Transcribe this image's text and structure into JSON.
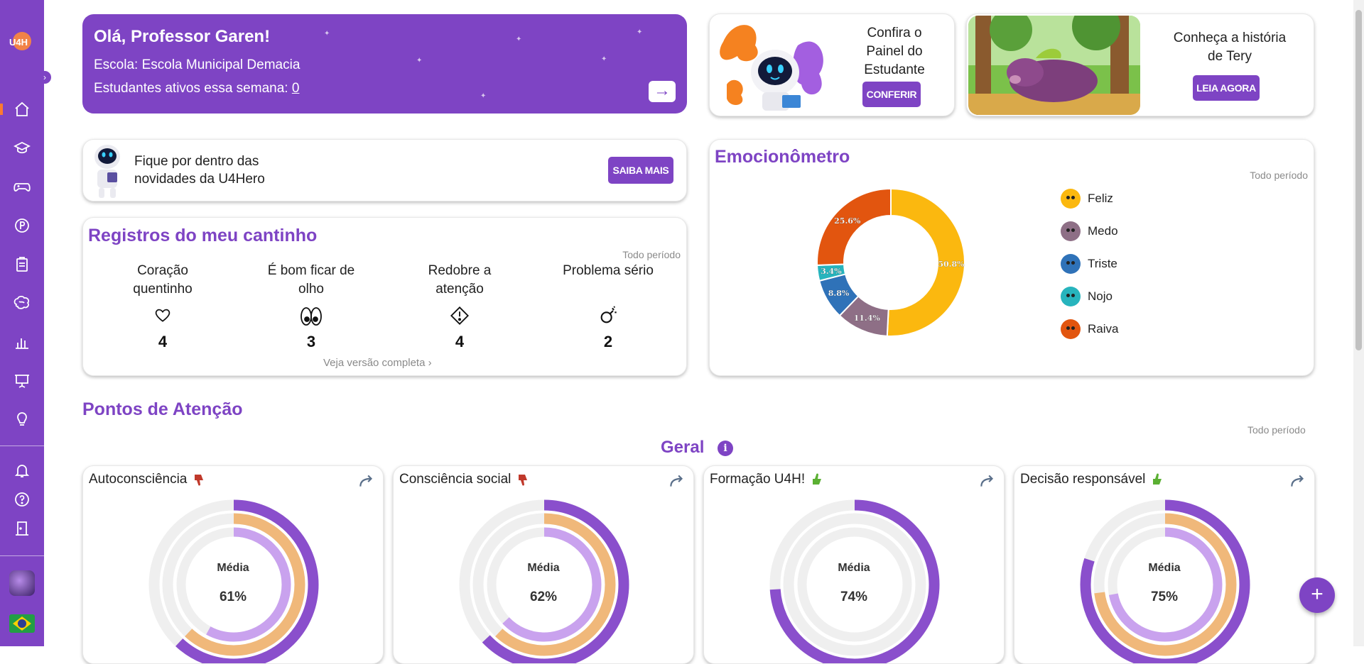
{
  "sidebar": {
    "logo_alt": "U4Hero",
    "items": [
      {
        "name": "home-icon",
        "active": true
      },
      {
        "name": "graduation-icon"
      },
      {
        "name": "gamepad-icon"
      },
      {
        "name": "p-coin-icon"
      },
      {
        "name": "clipboard-icon"
      },
      {
        "name": "brain-icon"
      },
      {
        "name": "bar-chart-icon"
      },
      {
        "name": "presentation-icon"
      },
      {
        "name": "lightbulb-icon"
      },
      {
        "name": "bell-icon"
      },
      {
        "name": "help-icon"
      },
      {
        "name": "logout-door-icon"
      }
    ]
  },
  "welcome": {
    "greeting": "Olá, Professor Garen!",
    "school": "Escola: Escola Municipal Demacia",
    "active_label": "Estudantes ativos essa semana: ",
    "active_count": "0"
  },
  "promo_student": {
    "title": "Confira o Painel do Estudante",
    "button": "CONFERIR"
  },
  "promo_story": {
    "title": "Conheça a história de Tery",
    "button": "LEIA AGORA"
  },
  "news": {
    "text": "Fique por dentro das novidades da U4Hero",
    "button": "SAIBA MAIS"
  },
  "registros": {
    "title": "Registros do meu cantinho",
    "period": "Todo período",
    "items": [
      {
        "label": "Coração quentinho",
        "count": "4",
        "icon": "heart-icon"
      },
      {
        "label": "É bom ficar de olho",
        "count": "3",
        "icon": "eyes-icon"
      },
      {
        "label": "Redobre a atenção",
        "count": "4",
        "icon": "warning-icon"
      },
      {
        "label": "Problema sério",
        "count": "2",
        "icon": "bomb-icon"
      }
    ],
    "link": "Veja versão completa"
  },
  "emocionometro": {
    "title": "Emocionômetro",
    "period": "Todo período",
    "legend": [
      {
        "label": "Feliz",
        "color": "#fbb80f"
      },
      {
        "label": "Medo",
        "color": "#8e6f86"
      },
      {
        "label": "Triste",
        "color": "#2f72b8"
      },
      {
        "label": "Nojo",
        "color": "#27b4bd"
      },
      {
        "label": "Raiva",
        "color": "#e2550f"
      }
    ]
  },
  "chart_data": {
    "type": "pie",
    "categories": [
      "Feliz",
      "Medo",
      "Triste",
      "Nojo",
      "Raiva"
    ],
    "values": [
      50.8,
      11.4,
      8.8,
      3.4,
      25.6
    ],
    "labels": [
      "50.8%",
      "11.4%",
      "8.8%",
      "3.4%",
      "25.6%"
    ],
    "colors": [
      "#fbb80f",
      "#8e6f86",
      "#2f72b8",
      "#27b4bd",
      "#e2550f"
    ],
    "donut": true,
    "legend": "right"
  },
  "pontos": {
    "title": "Pontos de Atenção",
    "period": "Todo período",
    "group": "Geral",
    "media_label": "Média",
    "cards": [
      {
        "title": "Autoconsciência",
        "thumb": "down",
        "pct": "61%",
        "value": 61,
        "outer": 0.62,
        "middle": 0.62,
        "inner": 0.58
      },
      {
        "title": "Consciência social",
        "thumb": "down",
        "pct": "62%",
        "value": 62,
        "outer": 0.63,
        "middle": 0.62,
        "inner": 0.63
      },
      {
        "title": "Formação U4H!",
        "thumb": "up",
        "pct": "74%",
        "value": 74,
        "outer": 0.74,
        "middle": 0,
        "inner": 0
      },
      {
        "title": "Decisão responsável",
        "thumb": "up",
        "pct": "75%",
        "value": 75,
        "outer": 0.8,
        "middle": 0.73,
        "inner": 0.72
      }
    ]
  },
  "colors": {
    "brand": "#7e44c4",
    "outer_ring": "#8a4fcc",
    "middle_ring": "#f0b87a",
    "inner_ring": "#c9a2ee",
    "thumb_down": "#c0392b",
    "thumb_up": "#5bb033"
  }
}
